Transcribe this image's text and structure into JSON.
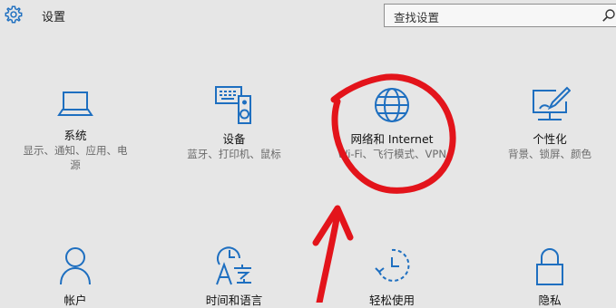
{
  "window": {
    "title": "设置"
  },
  "search": {
    "placeholder": "查找设置"
  },
  "colors": {
    "accent": "#1e6fc0",
    "background": "#e6e6e6",
    "annotation": "#e3141b"
  },
  "tiles": [
    {
      "name": "系统",
      "desc_line1": "显示、通知、应用、电",
      "desc_line2": "源",
      "icon": "laptop-icon"
    },
    {
      "name": "设备",
      "desc_line1": "蓝牙、打印机、鼠标",
      "icon": "devices-icon"
    },
    {
      "name": "网络和 Internet",
      "desc_line1": "Wi-Fi、飞行模式、VPN",
      "icon": "globe-icon"
    },
    {
      "name": "个性化",
      "desc_line1": "背景、锁屏、颜色",
      "icon": "personalization-icon"
    },
    {
      "name": "帐户",
      "icon": "person-icon"
    },
    {
      "name": "时间和语言",
      "icon": "time-language-icon"
    },
    {
      "name": "轻松使用",
      "icon": "ease-of-access-icon"
    },
    {
      "name": "隐私",
      "icon": "lock-icon"
    }
  ]
}
